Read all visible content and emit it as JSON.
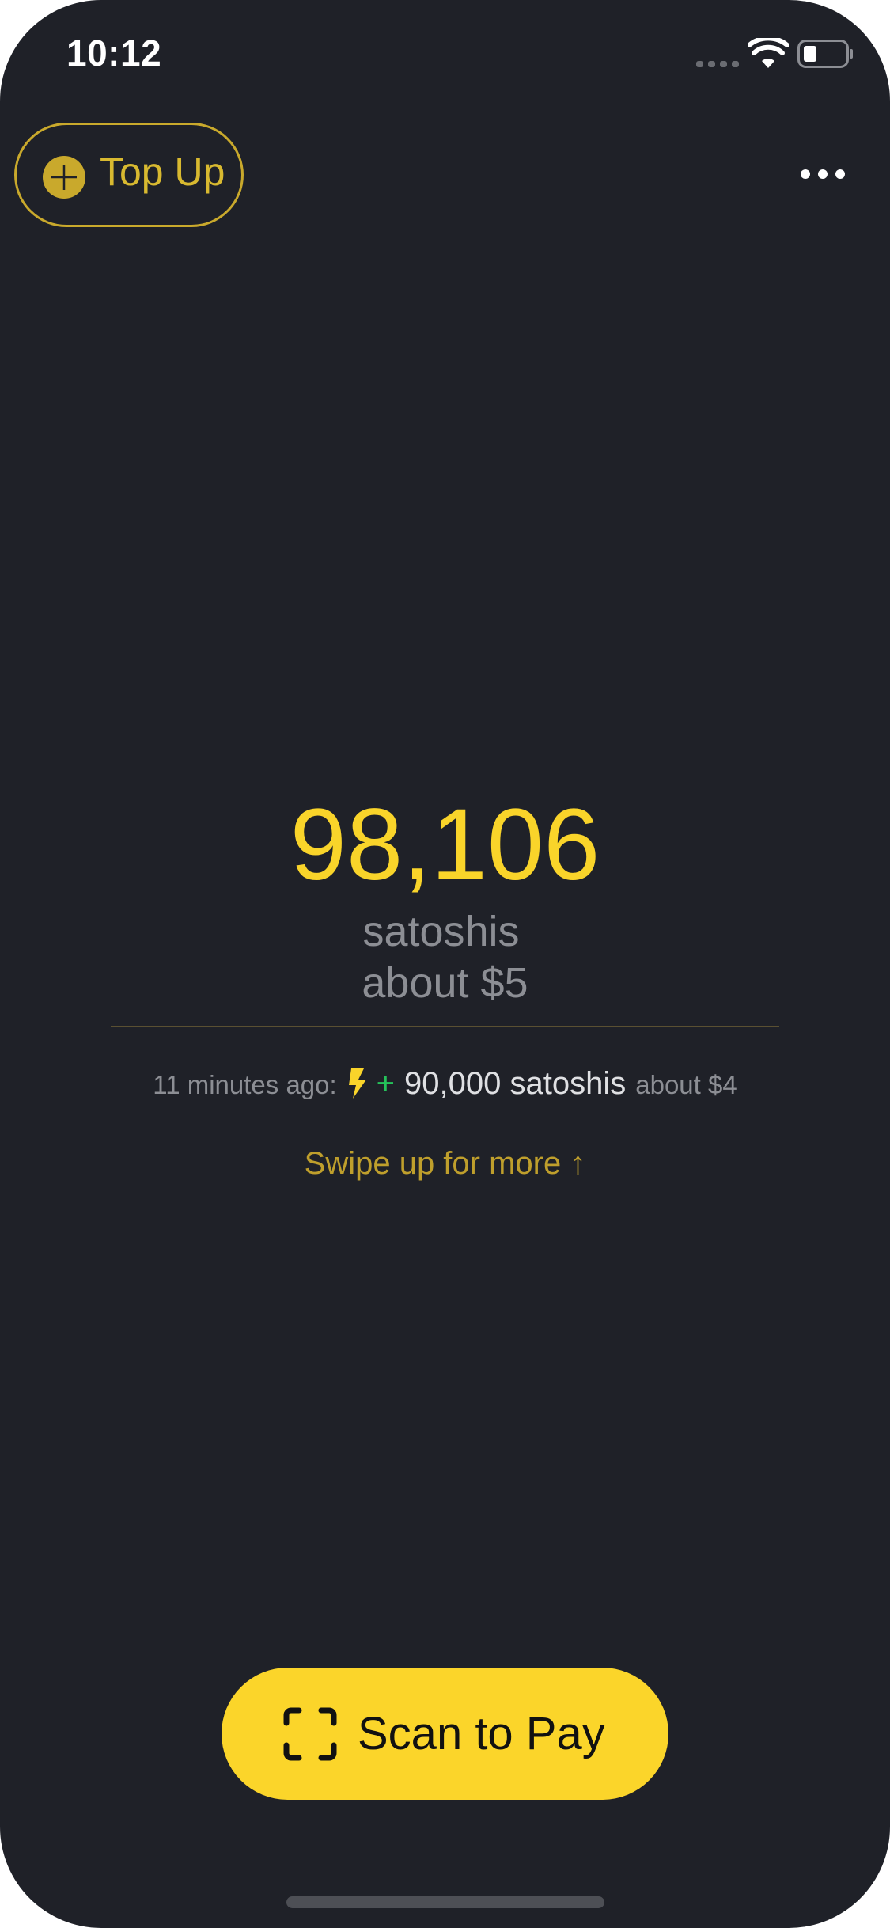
{
  "status_bar": {
    "time": "10:12"
  },
  "header": {
    "top_up_label": "Top Up",
    "top_up_icon": "plus-circle-icon",
    "more_icon": "more-horizontal-icon"
  },
  "balance": {
    "amount": "98,106",
    "unit": "satoshis",
    "fiat": "about $5"
  },
  "last_transaction": {
    "time": "11 minutes ago:",
    "icon": "lightning-icon",
    "sign": "+",
    "amount": "90,000 satoshis",
    "fiat": "about $4"
  },
  "swipe_hint": "Swipe up for more ↑",
  "scan_button": {
    "label": "Scan to Pay",
    "icon": "scan-frame-icon"
  },
  "colors": {
    "background": "#1f2128",
    "accent": "#f9d42a",
    "positive": "#25c25a",
    "muted": "#8c8e94"
  }
}
